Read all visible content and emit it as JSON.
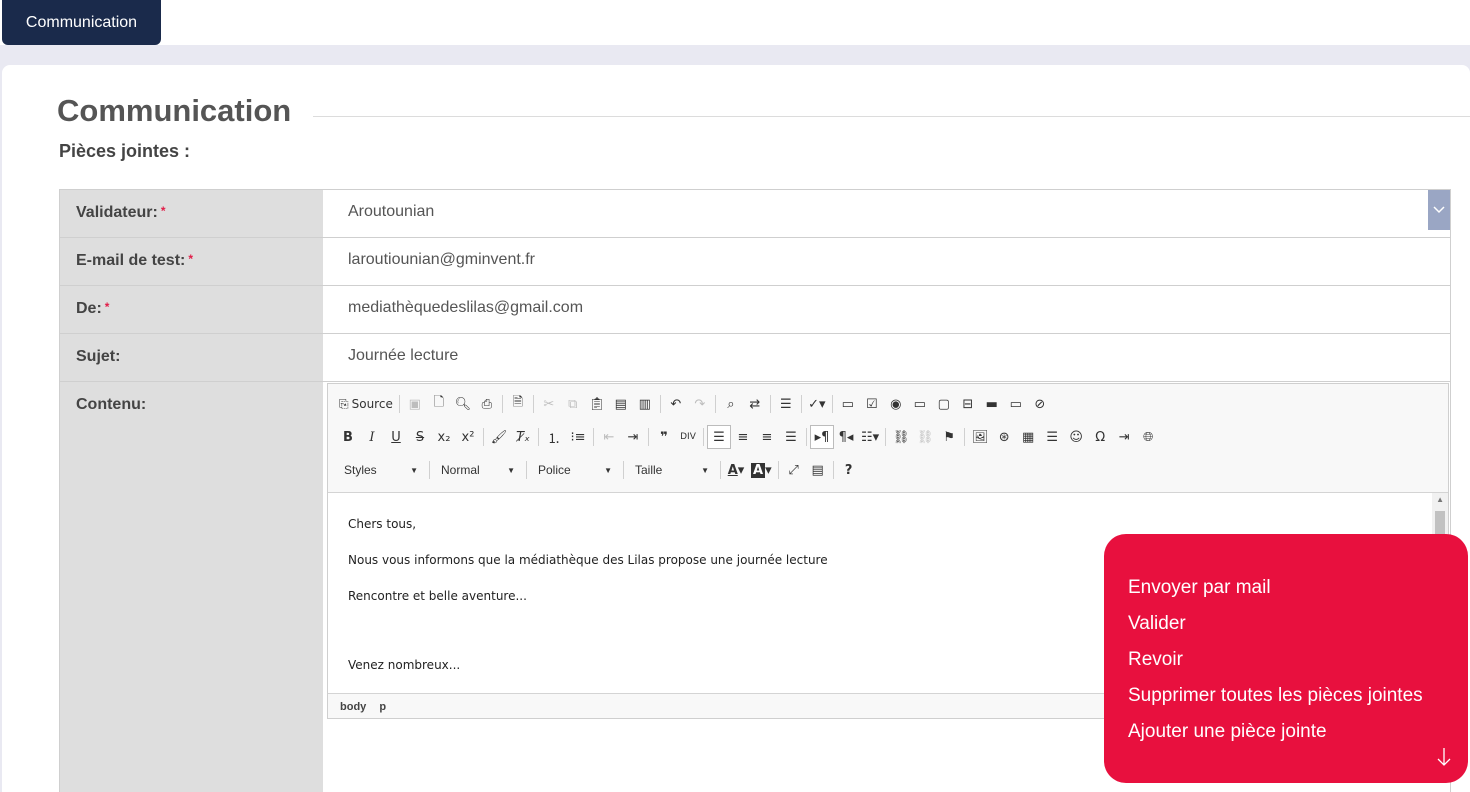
{
  "header": {
    "active_tab": "Communication"
  },
  "page": {
    "title": "Communication",
    "subtitle": "Pièces jointes :"
  },
  "form": {
    "validator": {
      "label": "Validateur:",
      "required": "*",
      "value": "Aroutounian"
    },
    "test_email": {
      "label": "E-mail de test:",
      "required": "*",
      "value": "laroutiounian@gminvent.fr"
    },
    "from": {
      "label": "De:",
      "required": "*",
      "value": "mediathèquedeslilas@gmail.com"
    },
    "subject": {
      "label": "Sujet:",
      "value": "Journée lecture"
    },
    "content": {
      "label": "Contenu:"
    }
  },
  "editor": {
    "source_label": "Source",
    "styles_label": "Styles",
    "format_label": "Normal",
    "font_label": "Police",
    "size_label": "Taille",
    "lines": [
      "Chers tous,",
      "Nous vous informons que la médiathèque des Lilas propose une journée lecture",
      "Rencontre et belle aventure...",
      "Venez nombreux..."
    ],
    "path": [
      "body",
      "p"
    ]
  },
  "actions": {
    "send_mail": "Envoyer par mail",
    "validate": "Valider",
    "review": "Revoir",
    "delete_all_attachments": "Supprimer toutes les pièces jointes",
    "add_attachment": "Ajouter une pièce jointe"
  },
  "colors": {
    "nav": "#1a2a4b",
    "action_menu": "#e8103e",
    "label_bg": "#dedede"
  }
}
